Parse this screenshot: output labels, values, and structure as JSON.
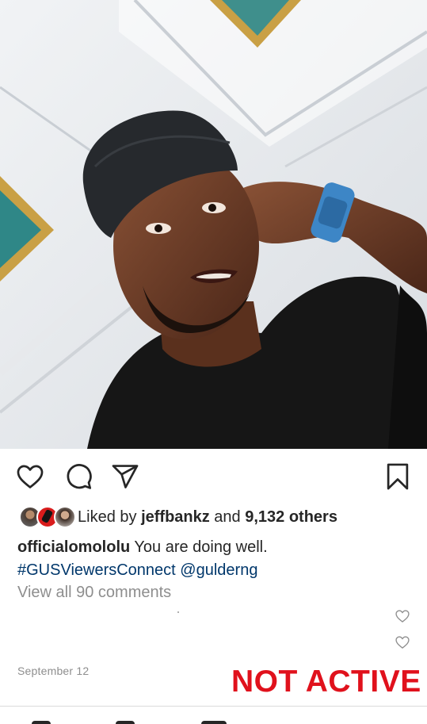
{
  "post": {
    "image_alt": "Selfie of a man in a black cap and black t-shirt wearing a blue smartwatch",
    "actions": {
      "like_icon": "heart-outline-icon",
      "comment_icon": "comment-bubble-icon",
      "share_icon": "paper-plane-icon",
      "save_icon": "bookmark-icon"
    },
    "likes": {
      "prefix": "Liked by ",
      "user": "jeffbankz",
      "middle": " and ",
      "others": "9,132 others"
    },
    "caption": {
      "username": "officialomololu",
      "text": " You are doing well.",
      "hashtag": "#GUSViewersConnect",
      "mention": "@gulderng"
    },
    "view_comments": "View all 90 comments",
    "date": "September 12",
    "stamp": "NOT ACTIVE"
  },
  "colors": {
    "link": "#00376b",
    "muted": "#8e8e8e",
    "stamp": "#e0111c",
    "text": "#262626"
  }
}
